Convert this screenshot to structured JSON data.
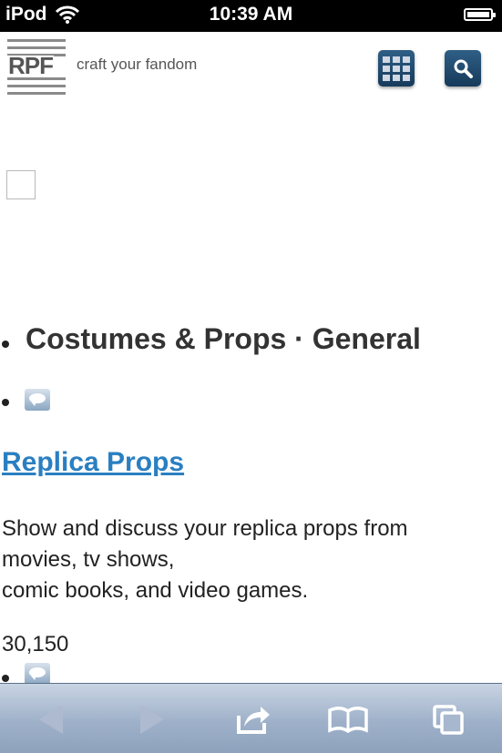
{
  "status_bar": {
    "carrier": "iPod",
    "time": "10:39 AM",
    "icons": [
      "wifi-icon",
      "battery-icon"
    ]
  },
  "header": {
    "logo_text": "RPF",
    "tagline": "craft your fandom",
    "buttons": [
      "grid-menu-icon",
      "search-icon"
    ]
  },
  "content": {
    "category_heading": "Costumes & Props · General",
    "forum": {
      "title": "Replica Props",
      "description": [
        "Show and discuss your replica props from",
        "movies, tv shows,",
        "comic books, and video games."
      ],
      "count": "30,150"
    }
  },
  "toolbar": {
    "buttons": [
      "back-icon",
      "forward-icon",
      "share-icon",
      "bookmarks-icon",
      "tabs-icon"
    ]
  },
  "colors": {
    "link": "#2a7fc1",
    "header_button": "#1f4a6e",
    "toolbar": "#9fb1c9"
  }
}
